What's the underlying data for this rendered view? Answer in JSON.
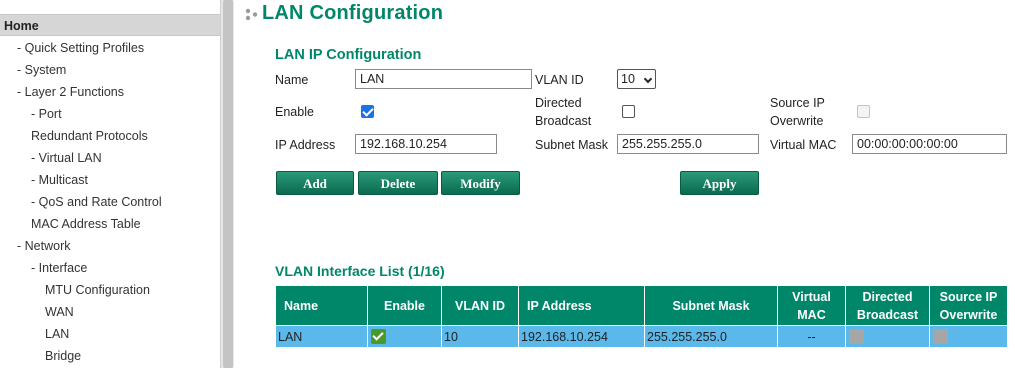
{
  "sidebar": {
    "items": [
      {
        "label": "Home"
      },
      {
        "label": "- Quick Setting Profiles"
      },
      {
        "label": "- System"
      },
      {
        "label": "- Layer 2 Functions"
      },
      {
        "label": "- Port"
      },
      {
        "label": "Redundant Protocols"
      },
      {
        "label": "- Virtual LAN"
      },
      {
        "label": "- Multicast"
      },
      {
        "label": "- QoS and Rate Control"
      },
      {
        "label": "MAC Address Table"
      },
      {
        "label": "- Network"
      },
      {
        "label": "- Interface"
      },
      {
        "label": "MTU Configuration"
      },
      {
        "label": "WAN"
      },
      {
        "label": "LAN"
      },
      {
        "label": "Bridge"
      }
    ]
  },
  "page": {
    "title": "LAN Configuration"
  },
  "form": {
    "section_title": "LAN IP Configuration",
    "name_label": "Name",
    "name_value": "LAN",
    "vlan_id_label": "VLAN ID",
    "vlan_id_value": "10",
    "enable_label": "Enable",
    "enable_checked": true,
    "directed_broadcast_label_1": "Directed",
    "directed_broadcast_label_2": "Broadcast",
    "directed_broadcast_checked": false,
    "source_ip_overwrite_label_1": "Source IP",
    "source_ip_overwrite_label_2": "Overwrite",
    "source_ip_overwrite_checked": false,
    "ip_address_label": "IP Address",
    "ip_address_value": "192.168.10.254",
    "subnet_mask_label": "Subnet Mask",
    "subnet_mask_value": "255.255.255.0",
    "virtual_mac_label": "Virtual MAC",
    "virtual_mac_value": "00:00:00:00:00:00"
  },
  "buttons": {
    "add": "Add",
    "delete": "Delete",
    "modify": "Modify",
    "apply": "Apply"
  },
  "table": {
    "section_title": "VLAN Interface List (1/16)",
    "headers": {
      "name": "Name",
      "enable": "Enable",
      "vlan_id": "VLAN ID",
      "ip_address": "IP Address",
      "subnet_mask": "Subnet Mask",
      "virtual_mac_1": "Virtual",
      "virtual_mac_2": "MAC",
      "directed_broadcast_1": "Directed",
      "directed_broadcast_2": "Broadcast",
      "source_ip_overwrite_1": "Source IP",
      "source_ip_overwrite_2": "Overwrite"
    },
    "rows": [
      {
        "name": "LAN",
        "enable": true,
        "vlan_id": "10",
        "ip_address": "192.168.10.254",
        "subnet_mask": "255.255.255.0",
        "virtual_mac": "--",
        "directed_broadcast": false,
        "source_ip_overwrite": false
      }
    ]
  },
  "colors": {
    "accent": "#008769",
    "row_highlight": "#5bb8ea",
    "checkbox_blue": "#1a73e8"
  }
}
